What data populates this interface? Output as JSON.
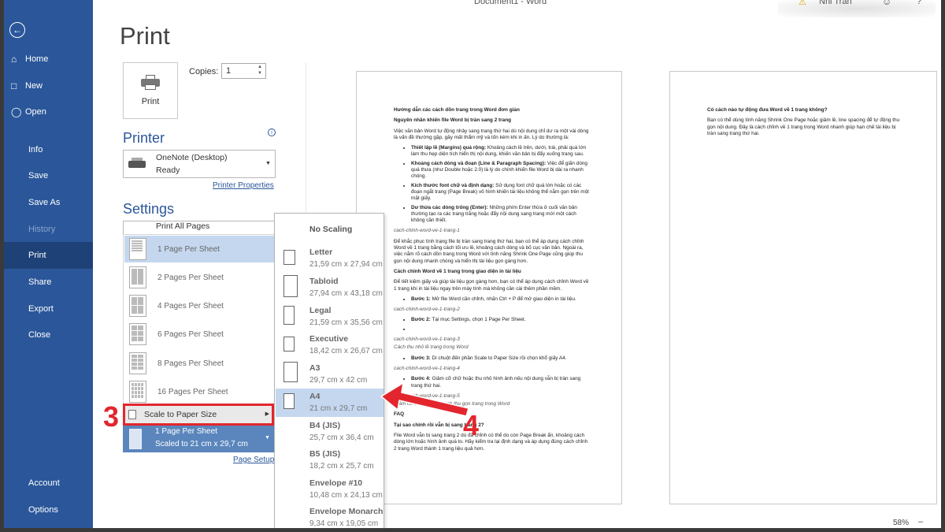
{
  "window": {
    "title": "Document1 - Word",
    "user": "Nhi Tran",
    "help": "?"
  },
  "sidebar": {
    "items": [
      {
        "label": "Home",
        "icon": "home-icon"
      },
      {
        "label": "New",
        "icon": "new-doc-icon"
      },
      {
        "label": "Open",
        "icon": "folder-icon"
      },
      {
        "label": "Info"
      },
      {
        "label": "Save"
      },
      {
        "label": "Save As"
      },
      {
        "label": "History"
      },
      {
        "label": "Print"
      },
      {
        "label": "Share"
      },
      {
        "label": "Export"
      },
      {
        "label": "Close"
      },
      {
        "label": "Account"
      },
      {
        "label": "Options"
      }
    ]
  },
  "print": {
    "title": "Print",
    "button_label": "Print",
    "copies_label": "Copies:",
    "copies_value": "1"
  },
  "printer": {
    "heading": "Printer",
    "name": "OneNote (Desktop)",
    "status": "Ready",
    "properties_link": "Printer Properties"
  },
  "settings": {
    "heading": "Settings",
    "print_all": "Print All Pages",
    "pages_per_sheet": [
      "1 Page Per Sheet",
      "2 Pages Per Sheet",
      "4 Pages Per Sheet",
      "6 Pages Per Sheet",
      "8 Pages Per Sheet",
      "16 Pages Per Sheet"
    ],
    "scale_to_paper": "Scale to Paper Size",
    "current_line1": "1 Page Per Sheet",
    "current_line2": "Scaled to 21 cm x 29,7 cm",
    "page_setup_link": "Page Setup"
  },
  "scale_menu": {
    "header": "No Scaling",
    "items": [
      {
        "name": "Letter",
        "dim": "21,59 cm x 27,94 cm"
      },
      {
        "name": "Tabloid",
        "dim": "27,94 cm x 43,18 cm"
      },
      {
        "name": "Legal",
        "dim": "21,59 cm x 35,56 cm"
      },
      {
        "name": "Executive",
        "dim": "18,42 cm x 26,67 cm"
      },
      {
        "name": "A3",
        "dim": "29,7 cm x 42 cm"
      },
      {
        "name": "A4",
        "dim": "21 cm x 29,7 cm"
      },
      {
        "name": "B4 (JIS)",
        "dim": "25,7 cm x 36,4 cm"
      },
      {
        "name": "B5 (JIS)",
        "dim": "18,2 cm x 25,7 cm"
      },
      {
        "name": "Envelope #10",
        "dim": "10,48 cm x 24,13 cm"
      },
      {
        "name": "Envelope Monarch",
        "dim": "9,34 cm x 19,05 cm"
      }
    ],
    "highlighted": "A4"
  },
  "annotations": {
    "step3": "3",
    "step4": "4"
  },
  "preview": {
    "zoom": "58%",
    "page1": {
      "h1": "Hướng dẫn các cách dồn trang trong Word đơn giản",
      "h2": "Nguyên nhân khiến file Word bị tràn sang 2 trang",
      "intro": "Việc văn bản Word tự động nhảy sang trang thứ hai dù nội dung chỉ dư ra một vài dòng là vấn đề thường gặp, gây mất thẩm mỹ và tốn kém khi in ấn. Lý do thường là:",
      "bullets": [
        {
          "b": "Thiết lập lề (Margins) quá rộng:",
          "t": " Khoảng cách lề trên, dưới, trái, phải quá lớn làm thu hẹp diện tích hiển thị nội dung, khiến văn bản bị đẩy xuống trang sau."
        },
        {
          "b": "Khoảng cách dòng và đoạn (Line & Paragraph Spacing):",
          "t": " Việc để giãn dòng quá thưa (như Double hoặc 2.0) là lý do chính khiến file Word bị dài ra nhanh chóng."
        },
        {
          "b": "Kích thước font chữ và định dạng:",
          "t": " Sử dụng font chữ quá lớn hoặc có các đoạn ngắt trang (Page Break) vô hình khiến tài liệu không thể nằm gọn trên một mặt giấy."
        },
        {
          "b": "Dư thừa các dòng trống (Enter):",
          "t": " Những phím Enter thừa ở cuối văn bản thường tạo ra các trang trắng hoặc đẩy nội dung sang trang mới một cách không cần thiết."
        }
      ],
      "cap1": "cach-chinh-word-ve-1-trang-1",
      "para2": "Để khắc phục tình trạng file bị tràn sang trang thứ hai, bạn có thể áp dụng cách chỉnh Word về 1 trang bằng cách tối ưu lề, khoảng cách dòng và bố cục văn bản. Ngoài ra, việc nắm rõ cách dồn trang trong Word với tính năng Shrink One Page cũng giúp thu gọn nội dung nhanh chóng và hiển thị tài liệu gọn gàng hơn.",
      "h3": "Cách chỉnh Word về 1 trang trong giao diện in tài liệu",
      "para3": "Để tiết kiệm giấy và giúp tài liệu gọn gàng hơn, bạn có thể áp dụng cách chỉnh Word về 1 trang khi in tài liệu ngay trên máy tính mà không cần cài thêm phần mềm.",
      "s1b": "Bước 1:",
      "s1": " Mở file Word cần chỉnh, nhấn Ctrl + P để mở giao diện in tài liệu.",
      "cap2": "cach-chinh-word-ve-1-trang-2",
      "s2b": "Bước 2:",
      "s2": " Tại mục Settings, chọn 1 Page Per Sheet.",
      "cap3": "cach-chinh-word-ve-1-trang-3",
      "cap3b": "Cách thu nhỏ lề trang trong Word",
      "s3b": "Bước 3:",
      "s3": " Di chuột đến phần Scale to Paper Size rồi chọn khổ giấy A4.",
      "cap4": "cach-chinh-word-ve-1-trang-4",
      "s4b": "Bước 4:",
      "s4": " Giảm cỡ chữ hoặc thu nhỏ hình ảnh nếu nội dung vẫn bị tràn sang trang thứ hai.",
      "cap5": "cach-chinh-word-ve-1-trang-5",
      "cap5b": "Giảm cỡ chữ cũng là cách thu gọn trang trong Word",
      "faq": "FAQ",
      "q1": "Tại sao chỉnh rồi vẫn bị sang trang 2?",
      "a1": "File Word vẫn bị sang trang 2 dù đã chỉnh có thể do còn Page Break ẩn, khoảng cách dòng lớn hoặc hình ảnh quá to. Hãy kiểm tra lại định dạng và áp dụng đúng cách chỉnh 2 trang Word thành 1 trang liệu quả hơn."
    },
    "page2": {
      "q2": "Có cách nào tự động đưa Word về 1 trang không?",
      "a2": "Bạn có thể dùng tính năng Shrink One Page hoặc giảm lề, line spacing để tự động thu gọn nội dung. Đây là cách chỉnh về 1 trang trong Word nhanh giúp hạn chế tài liệu bị tràn sang trang thứ hai."
    }
  }
}
